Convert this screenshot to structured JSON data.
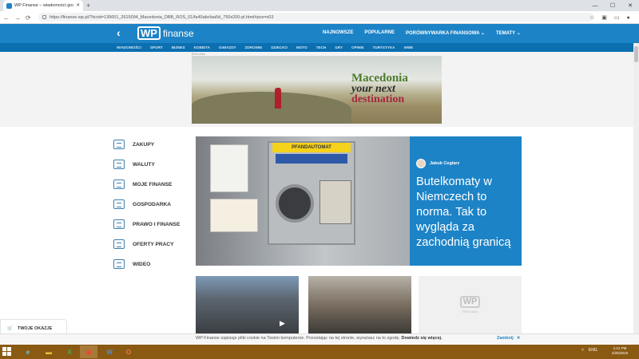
{
  "browser": {
    "tab_title": "WP Finanse – wiadomości gosp...",
    "new_tab": "+",
    "url": "https://finanse.wp.pl/?ticrid=139651_2615094_Macedonia_DBB_ROS_01/fa40abcfaa5d_750x200-pl.html#pos=x03",
    "window_controls": [
      "—",
      "☐",
      "✕"
    ]
  },
  "site": {
    "logo_wp": "WP",
    "logo_name": "finanse",
    "top_nav": [
      "NAJNOWSZE",
      "POPULARNE",
      "PORÓWNYWARKA FINANSOWA ⌄",
      "TEMATY ⌄"
    ],
    "sub_nav": [
      "WIADOMOŚCI",
      "SPORT",
      "BIZNES",
      "KOBIETA",
      "GWIAZDY",
      "ZDROWIE",
      "DZIECKO",
      "MOTO",
      "TECH",
      "GRY",
      "OPINIE",
      "TURYSTYKA",
      "WWE"
    ]
  },
  "ad": {
    "label": "REKLAMA",
    "line1": "Macedonia",
    "line2": "your next",
    "line3": "destination"
  },
  "sidebar": [
    {
      "label": "ZAKUPY",
      "icon": "shopping-icon"
    },
    {
      "label": "WALUTY",
      "icon": "currency-icon"
    },
    {
      "label": "MOJE FINANSE",
      "icon": "wallet-icon"
    },
    {
      "label": "GOSPODARKA",
      "icon": "factory-icon"
    },
    {
      "label": "PRAWO I FINANSE",
      "icon": "scales-icon"
    },
    {
      "label": "OFERTY PRACY",
      "icon": "briefcase-icon"
    },
    {
      "label": "WIDEO",
      "icon": "video-icon"
    }
  ],
  "feature": {
    "author": "Jakub Ceglarz",
    "machine_label": "PFANDAUTOMAT",
    "headline": "Butelkomaty w Niemczech to norma. Tak to wygląda za zachodnią granicą"
  },
  "thumbs": {
    "ad_logo": "WP",
    "ad_label": "REKLAMA"
  },
  "cart": {
    "label": "TWOJE OKAZJE"
  },
  "cookie": {
    "text": "WP Finanse zapisuje pliki cookie na Twoim komputerze. Pozostając na tej stronie, wyrażasz na to zgodę.",
    "link": "Dowiedz się więcej.",
    "close": "Zamknij",
    "close_icon": "✕"
  },
  "taskbar": {
    "lang": "ENG",
    "time": "1:21 PM",
    "date": "4/25/2019"
  }
}
